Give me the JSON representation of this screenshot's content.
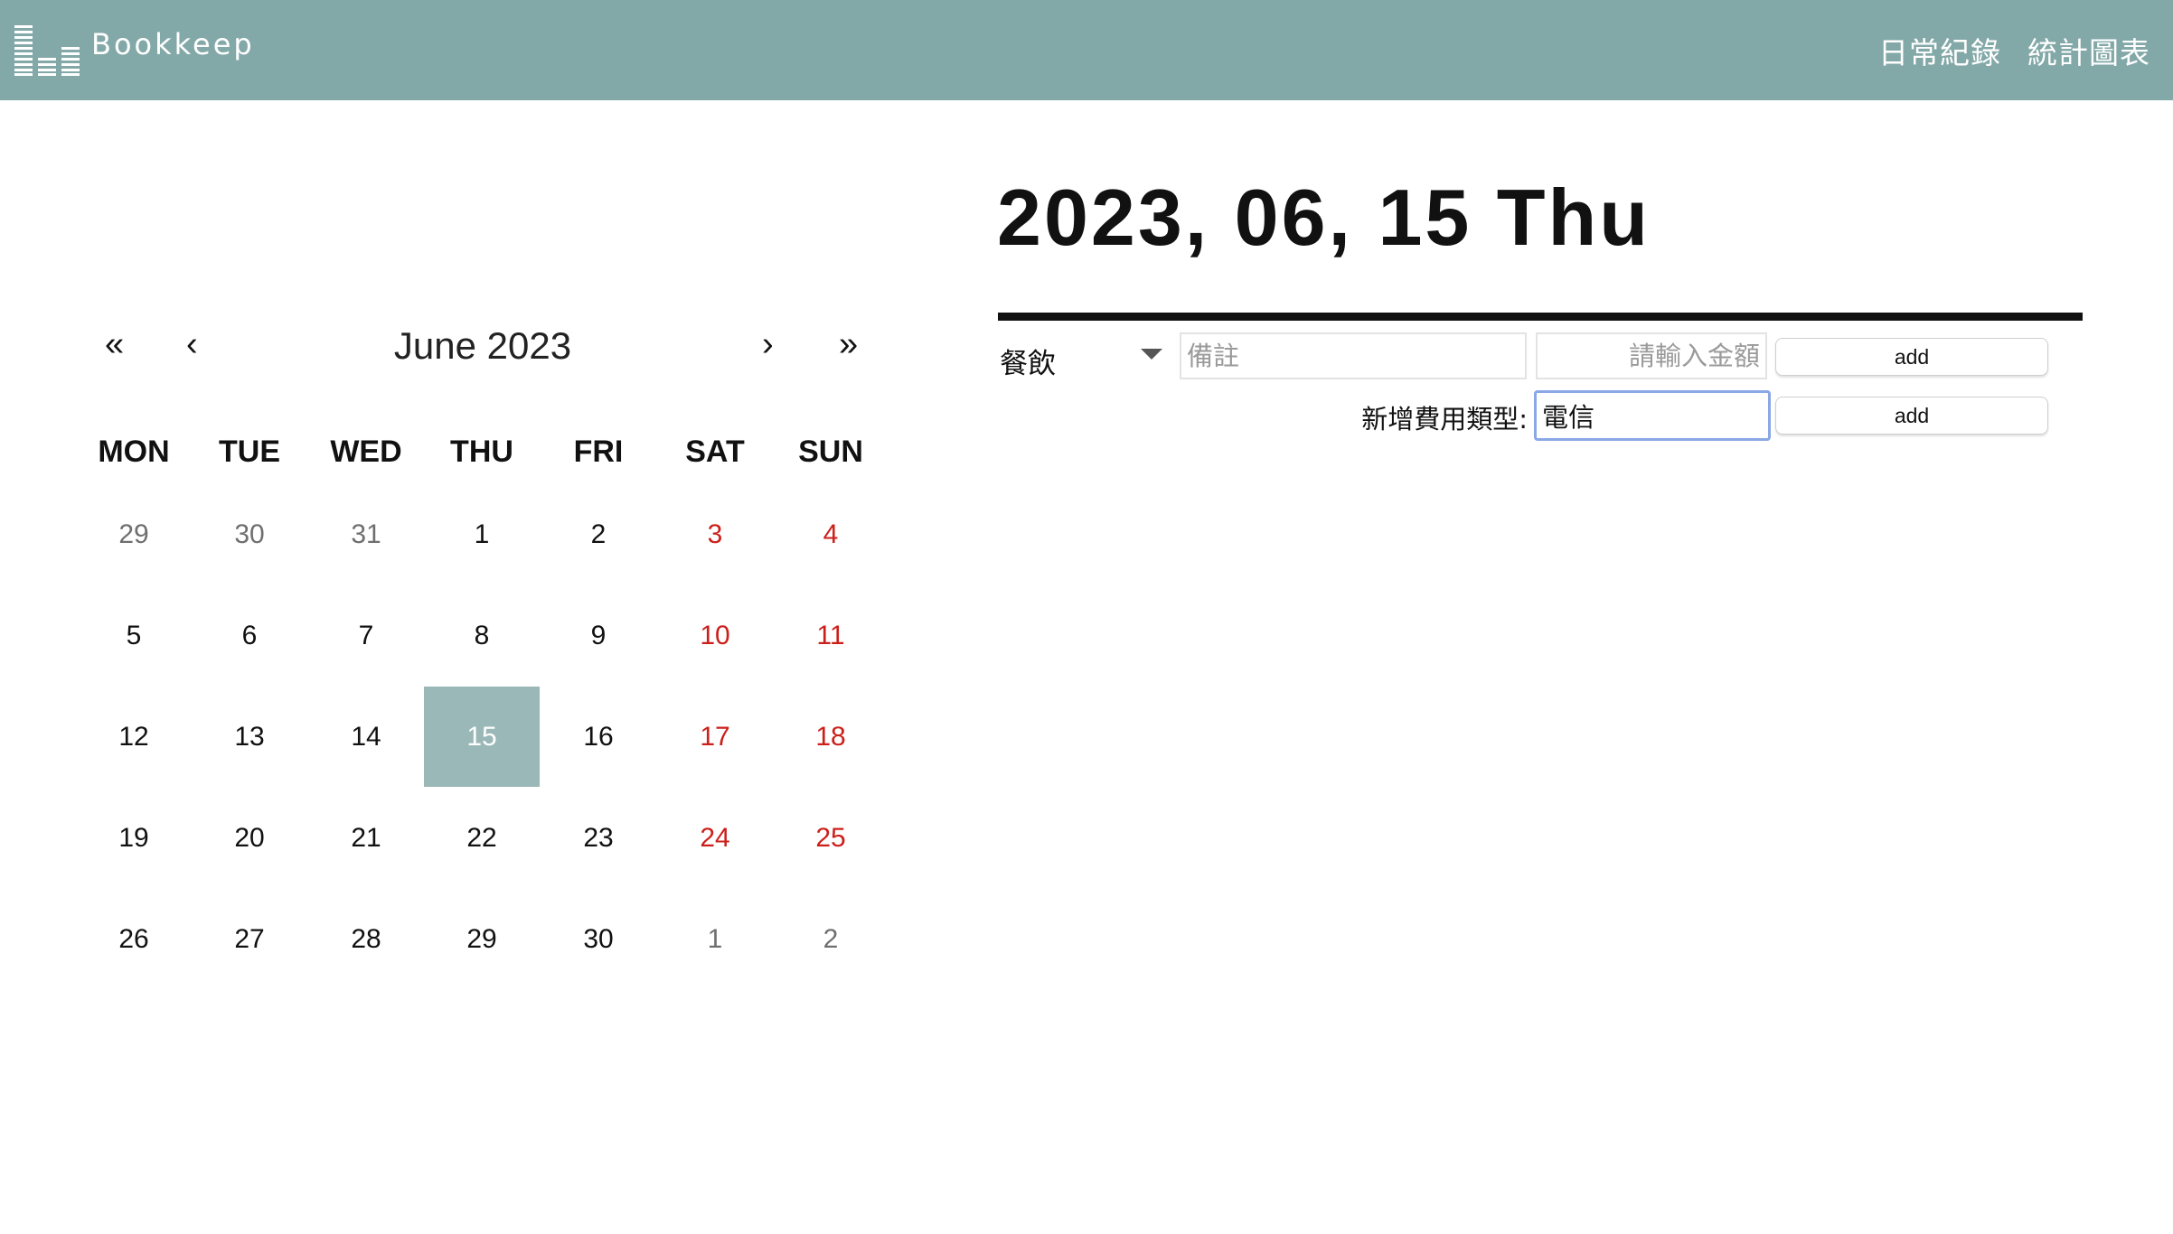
{
  "app": {
    "brand": "Bookkeep",
    "logo_icon": "equalizer-bars-icon",
    "header_color": "#83a8a8"
  },
  "nav": {
    "daily": "日常紀錄",
    "stats": "統計圖表"
  },
  "calendar": {
    "prev_year": "«",
    "prev_month": "‹",
    "title": "June 2023",
    "next_month": "›",
    "next_year": "»",
    "weekdays": [
      "MON",
      "TUE",
      "WED",
      "THU",
      "FRI",
      "SAT",
      "SUN"
    ],
    "weeks": [
      [
        {
          "label": "29",
          "state": "other"
        },
        {
          "label": "30",
          "state": "other"
        },
        {
          "label": "31",
          "state": "other"
        },
        {
          "label": "1",
          "state": "normal"
        },
        {
          "label": "2",
          "state": "normal"
        },
        {
          "label": "3",
          "state": "weekend"
        },
        {
          "label": "4",
          "state": "weekend"
        }
      ],
      [
        {
          "label": "5",
          "state": "normal"
        },
        {
          "label": "6",
          "state": "normal"
        },
        {
          "label": "7",
          "state": "normal"
        },
        {
          "label": "8",
          "state": "normal"
        },
        {
          "label": "9",
          "state": "normal"
        },
        {
          "label": "10",
          "state": "weekend"
        },
        {
          "label": "11",
          "state": "weekend"
        }
      ],
      [
        {
          "label": "12",
          "state": "normal"
        },
        {
          "label": "13",
          "state": "normal"
        },
        {
          "label": "14",
          "state": "normal"
        },
        {
          "label": "15",
          "state": "selected"
        },
        {
          "label": "16",
          "state": "normal"
        },
        {
          "label": "17",
          "state": "weekend"
        },
        {
          "label": "18",
          "state": "weekend"
        }
      ],
      [
        {
          "label": "19",
          "state": "normal"
        },
        {
          "label": "20",
          "state": "normal"
        },
        {
          "label": "21",
          "state": "normal"
        },
        {
          "label": "22",
          "state": "normal"
        },
        {
          "label": "23",
          "state": "normal"
        },
        {
          "label": "24",
          "state": "weekend"
        },
        {
          "label": "25",
          "state": "weekend"
        }
      ],
      [
        {
          "label": "26",
          "state": "normal"
        },
        {
          "label": "27",
          "state": "normal"
        },
        {
          "label": "28",
          "state": "normal"
        },
        {
          "label": "29",
          "state": "normal"
        },
        {
          "label": "30",
          "state": "normal"
        },
        {
          "label": "1",
          "state": "other"
        },
        {
          "label": "2",
          "state": "other"
        }
      ]
    ],
    "colors": {
      "weekend": "#cc1f1a",
      "other_month": "#6f6f6f",
      "selected_bg": "#9bb8b8"
    }
  },
  "entry": {
    "date_heading": "2023, 06, 15 Thu",
    "category": {
      "selected": "餐飲",
      "icon": "caret-down-icon"
    },
    "note": {
      "placeholder": "備註",
      "value": ""
    },
    "amount": {
      "placeholder": "請輸入金額",
      "value": ""
    },
    "add_expense_label": "add",
    "new_type_label": "新增費用類型:",
    "new_type_value": "電信",
    "add_type_label": "add"
  }
}
